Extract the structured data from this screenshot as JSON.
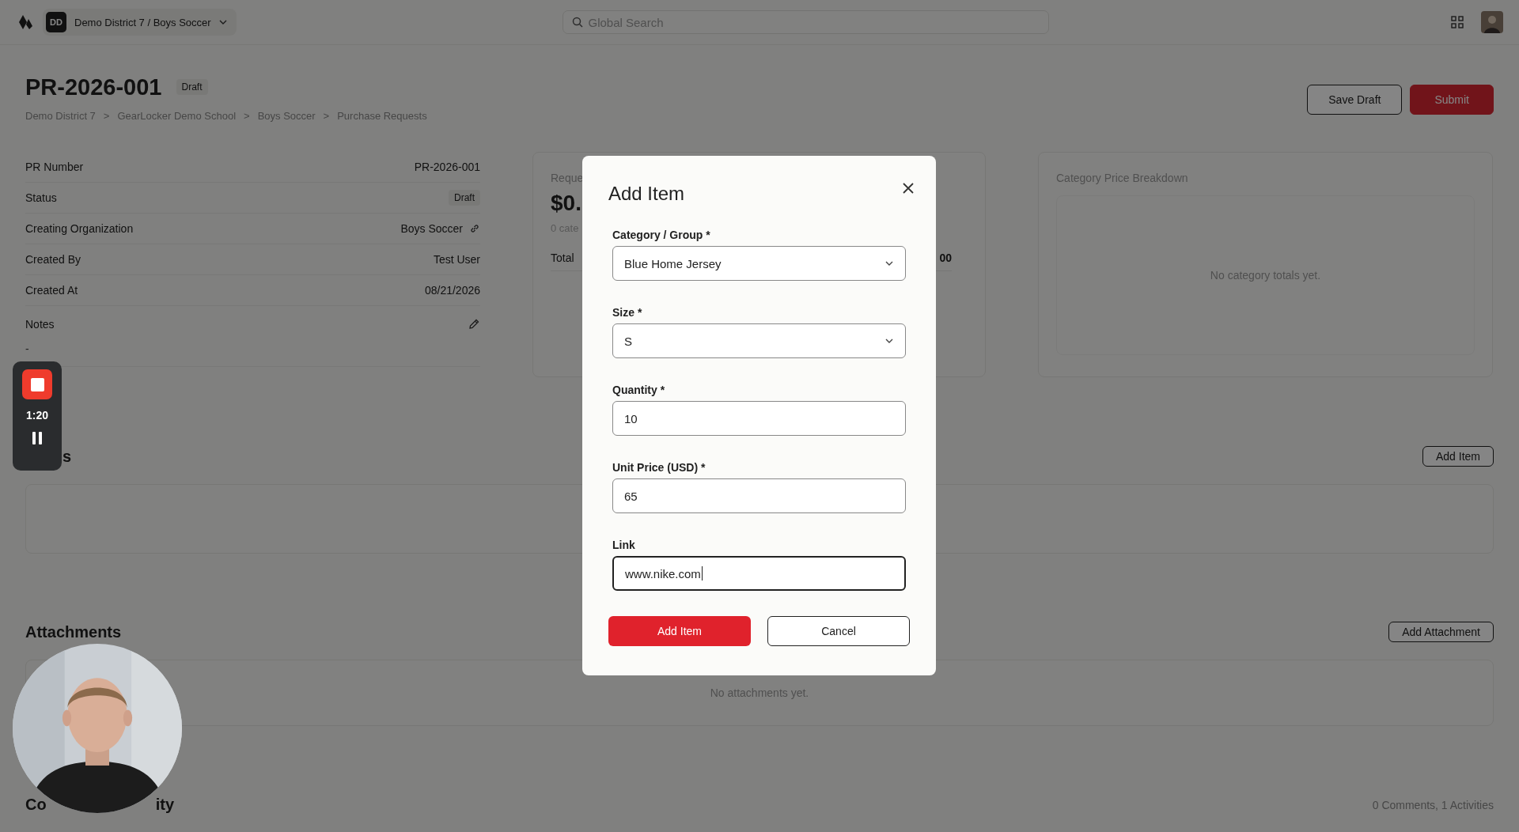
{
  "top_bar": {
    "org_badge": "DD",
    "org_switcher": "Demo District 7 / Boys Soccer",
    "search": {
      "placeholder": "Global Search"
    }
  },
  "header": {
    "title": "PR-2026-001",
    "status_badge": "Draft",
    "breadcrumbs": [
      {
        "text": "Demo District 7",
        "separator": ">"
      },
      {
        "text": "GearLocker Demo School",
        "separator": ">"
      },
      {
        "text": "Boys Soccer",
        "separator": ">"
      },
      {
        "text": "Purchase Requests"
      }
    ],
    "actions": [
      {
        "label": "Save Draft",
        "kind": "secondary"
      },
      {
        "label": "Submit",
        "kind": "primary"
      }
    ]
  },
  "details": [
    {
      "label": "PR Number",
      "value": "PR-2026-001",
      "kind": "text"
    },
    {
      "label": "Status",
      "value": "Draft",
      "kind": "badge"
    },
    {
      "label": "Creating Organization",
      "value": "Boys Soccer",
      "kind": "link"
    },
    {
      "label": "Created By",
      "value": "Test User",
      "kind": "text"
    },
    {
      "label": "Created At",
      "value": "08/21/2026",
      "kind": "text"
    }
  ],
  "notes": {
    "label": "Notes",
    "value": "-"
  },
  "summary_card": {
    "title": "Reque",
    "amount": "$0.",
    "subtitle": "0 cate",
    "total_label": "Total",
    "total_value": "00"
  },
  "breakdown_card": {
    "title": "Category Price Breakdown",
    "empty": "No category totals yet."
  },
  "items_section": {
    "title": "s",
    "button": "Add Item"
  },
  "attachments_section": {
    "title": "Attachments",
    "button": "Add Attachment",
    "empty": "No attachments yet."
  },
  "comments_section": {
    "title_parts": [
      "Co",
      "ity"
    ],
    "counts": "0 Comments, 1 Activities"
  },
  "modal": {
    "title": "Add Item",
    "fields": [
      {
        "label": "Category / Group *",
        "kind": "select",
        "value": "Blue Home Jersey",
        "focused": false
      },
      {
        "label": "Size *",
        "kind": "select",
        "value": "S",
        "focused": false
      },
      {
        "label": "Quantity *",
        "kind": "text",
        "value": "10",
        "focused": false
      },
      {
        "label": "Unit Price (USD) *",
        "kind": "text",
        "value": "65",
        "focused": false
      },
      {
        "label": "Link",
        "kind": "text",
        "value": "www.nike.com",
        "focused": true
      }
    ],
    "buttons": [
      {
        "label": "Add Item",
        "kind": "primary"
      },
      {
        "label": "Cancel",
        "kind": "secondary"
      }
    ]
  },
  "recorder": {
    "time": "1:20"
  }
}
